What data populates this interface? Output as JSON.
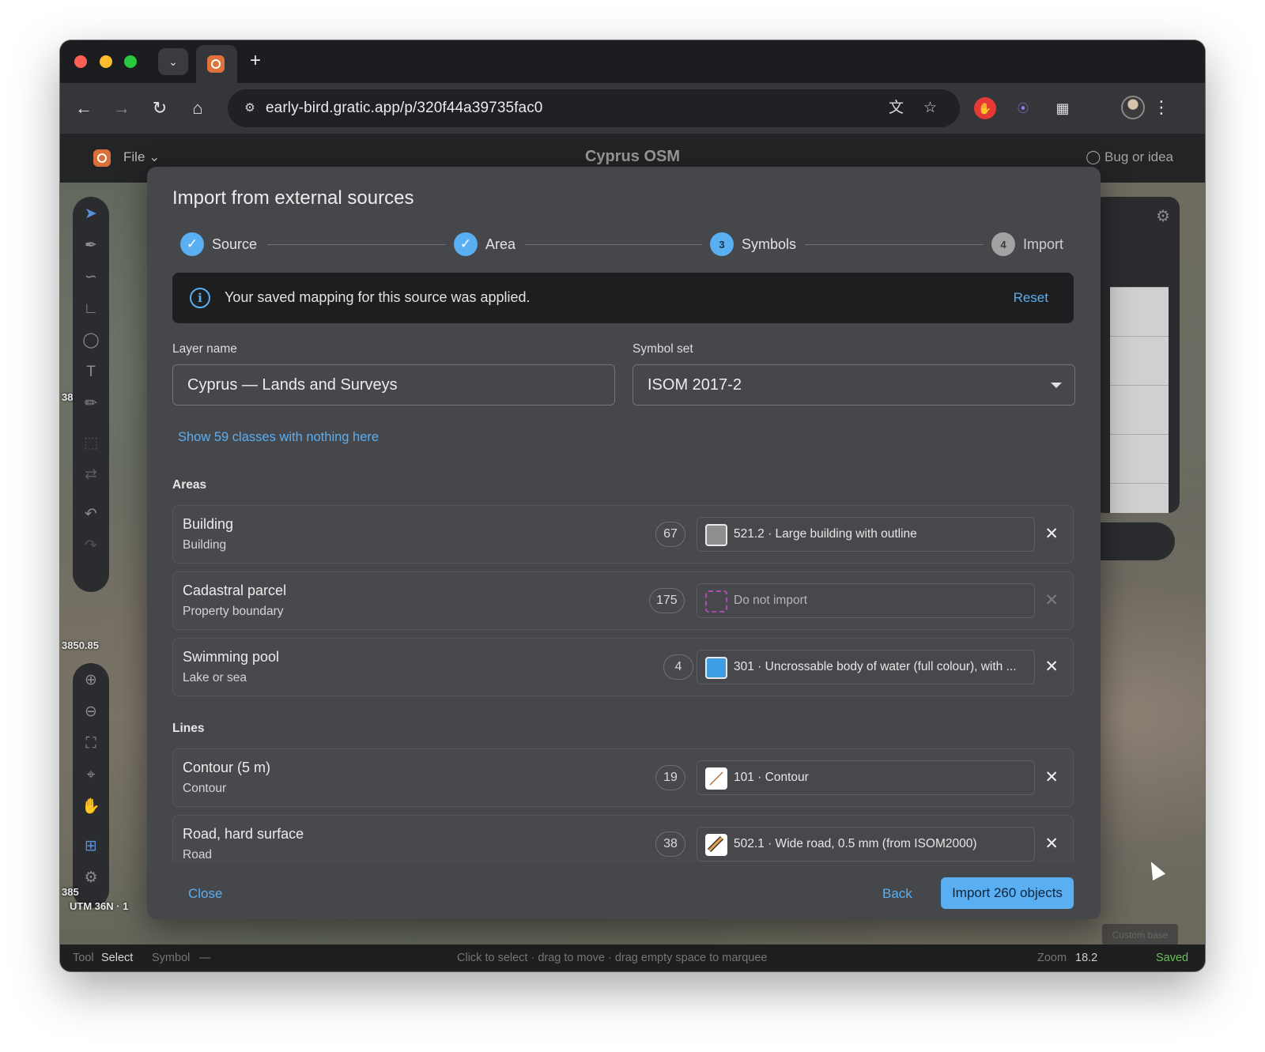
{
  "browser": {
    "url": "early-bird.gratic.app/p/320f44a39735fac0",
    "tab_search_icon": "chevron-down-icon",
    "new_tab_label": "+"
  },
  "app": {
    "file_menu": "File",
    "title": "Cyprus OSM",
    "feedback": "Bug or idea",
    "map_labels": {
      "scale_top": "38",
      "coordinate": "3850.85",
      "scale_bottom": "385",
      "projection": "UTM 36N · 1"
    },
    "corner_chip": "Custom base"
  },
  "status_bar": {
    "tool_label": "Tool",
    "tool_value": "Select",
    "symbol_label": "Symbol",
    "symbol_value": "—",
    "hint": "Click to select · drag to move · drag empty space to marquee",
    "zoom_label": "Zoom",
    "zoom_value": "18.2",
    "saved": "Saved"
  },
  "modal": {
    "title": "Import from external sources",
    "steps": [
      {
        "label": "Source",
        "state": "done",
        "marker": "✓"
      },
      {
        "label": "Area",
        "state": "done",
        "marker": "✓"
      },
      {
        "label": "Symbols",
        "state": "current",
        "marker": "3"
      },
      {
        "label": "Import",
        "state": "pending",
        "marker": "4"
      }
    ],
    "alert": {
      "text": "Your saved mapping for this source was applied.",
      "action": "Reset"
    },
    "layer_name": {
      "label": "Layer name",
      "value": "Cyprus — Lands and Surveys"
    },
    "symbol_set": {
      "label": "Symbol set",
      "value": "ISOM 2017-2"
    },
    "show_empty_link": "Show 59 classes with nothing here",
    "sections": {
      "areas": {
        "title": "Areas",
        "rows": [
          {
            "name": "Building",
            "sub": "Building",
            "count": "67",
            "symbol": "521.2 · Large building with outline",
            "swatch": "#8e8e8e",
            "active": true
          },
          {
            "name": "Cadastral parcel",
            "sub": "Property boundary",
            "count": "175",
            "symbol": "Do not import",
            "swatch": "none",
            "active": false
          },
          {
            "name": "Swimming pool",
            "sub": "Lake or sea",
            "count": "4",
            "symbol": "301 · Uncrossable body of water (full colour), with ...",
            "swatch": "#3d9ee4",
            "active": true
          }
        ]
      },
      "lines": {
        "title": "Lines",
        "rows": [
          {
            "name": "Contour (5 m)",
            "sub": "Contour",
            "count": "19",
            "symbol": "101 · Contour",
            "swatch": "contour",
            "active": true
          },
          {
            "name": "Road, hard surface",
            "sub": "Road",
            "count": "38",
            "symbol": "502.1 · Wide road, 0.5 mm (from ISOM2000)",
            "swatch": "road",
            "active": true
          }
        ]
      }
    },
    "footer": {
      "close": "Close",
      "back": "Back",
      "import": "Import 260 objects"
    }
  }
}
